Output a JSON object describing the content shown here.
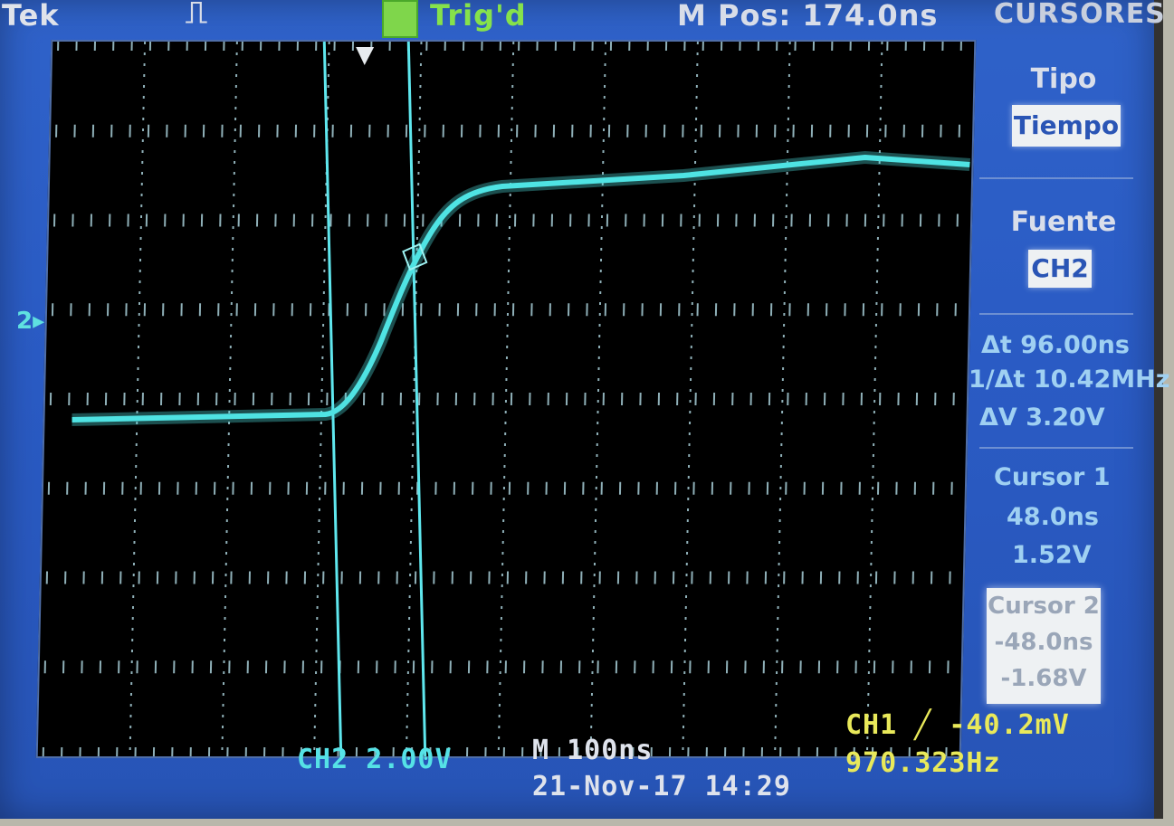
{
  "header": {
    "brand": "Tek",
    "trigger_glyph": "⎍",
    "run_state": "Trig'd",
    "horizontal_position": "M Pos: 174.0ns",
    "menu_title": "CURSORES"
  },
  "side_menu": {
    "type_label": "Tipo",
    "type_value": "Tiempo",
    "source_label": "Fuente",
    "source_value": "CH2",
    "delta_t": "Δt 96.00ns",
    "inv_delta_t": "1/Δt 10.42MHz",
    "delta_v": "ΔV 3.20V",
    "cursor1": {
      "label": "Cursor 1",
      "time": "48.0ns",
      "voltage": "1.52V"
    },
    "cursor2": {
      "label": "Cursor 2",
      "time": "-48.0ns",
      "voltage": "-1.68V"
    }
  },
  "status": {
    "ch2_scale": "CH2  2.00V",
    "timebase": "M 100ns",
    "datetime": "21-Nov-17 14:29",
    "trigger": "CH1 ╱ -40.2mV",
    "frequency": "970.323Hz"
  },
  "markers": {
    "ground": "2▸"
  },
  "colors": {
    "trace": "#4fe3e3",
    "cursor_line": "#5fe7ee",
    "screen_bg": "#2c5dc4",
    "graticule": "#8fb0b8"
  }
}
